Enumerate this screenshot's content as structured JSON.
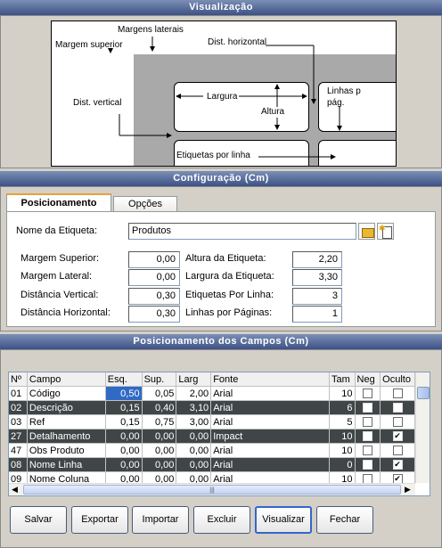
{
  "visualizacao": {
    "title": "Visualização",
    "labels": {
      "margens_laterais": "Margens laterais",
      "margem_superior": "Margem superior",
      "dist_horizontal": "Dist. horizontal",
      "largura": "Largura",
      "altura": "Altura",
      "dist_vertical": "Dist. vertical",
      "linhas_por_pag_1": "Linhas p",
      "linhas_por_pag_2": "pág.",
      "etiquetas_por_linha": "Etiquetas por linha"
    }
  },
  "configuracao": {
    "title": "Configuração  (Cm)",
    "tabs": [
      "Posicionamento",
      "Opções"
    ],
    "nome_label": "Nome da Etiqueta:",
    "nome_value": "Produtos",
    "fields_left": [
      {
        "label": "Margem Superior:",
        "value": "0,00"
      },
      {
        "label": "Margem Lateral:",
        "value": "0,00"
      },
      {
        "label": "Distância Vertical:",
        "value": "0,30"
      },
      {
        "label": "Distância Horizontal:",
        "value": "0,30"
      }
    ],
    "fields_right": [
      {
        "label": "Altura da Etiqueta:",
        "value": "2,20"
      },
      {
        "label": "Largura da Etiqueta:",
        "value": "3,30"
      },
      {
        "label": "Etiquetas Por Linha:",
        "value": "3"
      },
      {
        "label": "Linhas por Páginas:",
        "value": "1"
      }
    ]
  },
  "campos": {
    "title": "Posicionamento dos Campos  (Cm)",
    "columns": [
      "Nº",
      "Campo",
      "Esq.",
      "Sup.",
      "Larg",
      "Fonte",
      "Tam",
      "Neg",
      "Oculto"
    ],
    "rows": [
      {
        "n": "01",
        "campo": "Código",
        "esq": "0,50",
        "sup": "0,05",
        "larg": "2,00",
        "fonte": "Arial",
        "tam": "10",
        "neg": false,
        "oculto": false,
        "dark": false,
        "selected": true
      },
      {
        "n": "02",
        "campo": "Descrição",
        "esq": "0,15",
        "sup": "0,40",
        "larg": "3,10",
        "fonte": "Arial",
        "tam": "6",
        "neg": false,
        "oculto": false,
        "dark": true
      },
      {
        "n": "03",
        "campo": "Ref",
        "esq": "0,15",
        "sup": "0,75",
        "larg": "3,00",
        "fonte": "Arial",
        "tam": "5",
        "neg": false,
        "oculto": false,
        "dark": false
      },
      {
        "n": "27",
        "campo": "Detalhamento",
        "esq": "0,00",
        "sup": "0,00",
        "larg": "0,00",
        "fonte": "Impact",
        "tam": "10",
        "neg": false,
        "oculto": true,
        "dark": true
      },
      {
        "n": "47",
        "campo": "Obs Produto",
        "esq": "0,00",
        "sup": "0,00",
        "larg": "0,00",
        "fonte": "Arial",
        "tam": "10",
        "neg": false,
        "oculto": false,
        "dark": false
      },
      {
        "n": "08",
        "campo": "Nome Linha",
        "esq": "0,00",
        "sup": "0,00",
        "larg": "0,00",
        "fonte": "Arial",
        "tam": "0",
        "neg": false,
        "oculto": true,
        "dark": true
      },
      {
        "n": "09",
        "campo": "Nome Coluna",
        "esq": "0,00",
        "sup": "0,00",
        "larg": "0,00",
        "fonte": "Arial",
        "tam": "10",
        "neg": false,
        "oculto": true,
        "dark": false
      }
    ]
  },
  "buttons": [
    "Salvar",
    "Exportar",
    "Importar",
    "Excluir",
    "Visualizar",
    "Fechar"
  ]
}
